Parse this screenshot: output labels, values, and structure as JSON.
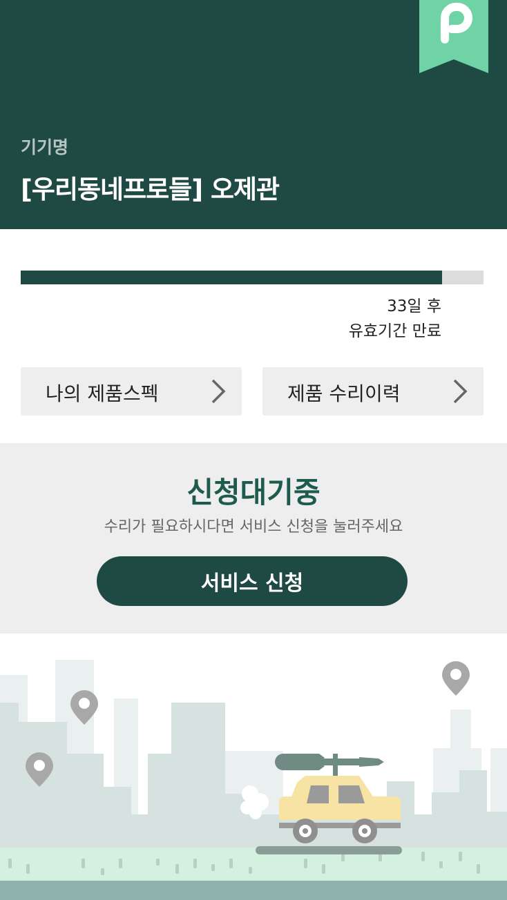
{
  "header": {
    "device_label": "기기명",
    "device_name": "[우리동네프로들] 오제관",
    "badge_icon": "p-bookmark-icon",
    "badge_color": "#6fd3a6",
    "background": "#1f4a43"
  },
  "warranty": {
    "progress_fraction": 0.91,
    "days_left": "33일 후",
    "expiry_text": "유효기간 만료"
  },
  "nav_buttons": [
    {
      "label": "나의 제품스펙",
      "icon": "chevron-right-icon"
    },
    {
      "label": "제품 수리이력",
      "icon": "chevron-right-icon"
    }
  ],
  "status": {
    "title": "신청대기중",
    "description": "수리가 필요하시다면 서비스 신청을 눌러주세요",
    "button_label": "서비스 신청",
    "accent": "#1f5a4e"
  },
  "illustration": {
    "icons": [
      "city-skyline",
      "map-pin-icon",
      "car-icon",
      "screwdriver-icon",
      "exhaust-smoke-icon",
      "grass-ground"
    ]
  }
}
